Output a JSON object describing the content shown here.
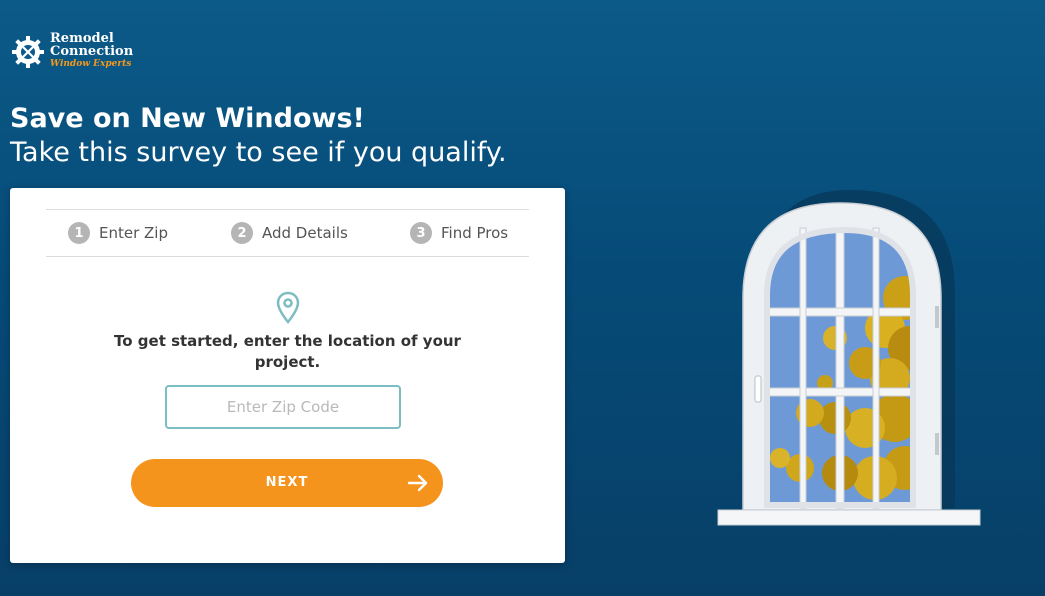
{
  "brand": {
    "line1": "Remodel",
    "line2": "Connection",
    "line3": "Window Experts",
    "accent_color": "#f39a1e"
  },
  "hero": {
    "title": "Save on New Windows!",
    "subtitle": "Take this survey to see if you qualify."
  },
  "steps": [
    {
      "number": "1",
      "label": "Enter Zip"
    },
    {
      "number": "2",
      "label": "Add Details"
    },
    {
      "number": "3",
      "label": "Find Pros"
    }
  ],
  "form": {
    "icon": "location-pin-icon",
    "prompt": "To get started, enter the location of your project.",
    "zip_value": "",
    "zip_placeholder": "Enter Zip Code",
    "next_label": "NEXT",
    "next_icon": "arrow-right-icon",
    "button_color": "#f5941d"
  },
  "illustration": {
    "icon": "arched-window-illustration"
  }
}
